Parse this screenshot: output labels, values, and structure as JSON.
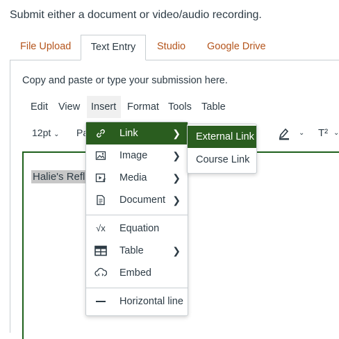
{
  "instruction": "Submit either a document or video/audio recording.",
  "tabs": [
    {
      "label": "File Upload"
    },
    {
      "label": "Text Entry"
    },
    {
      "label": "Studio"
    },
    {
      "label": "Google Drive"
    }
  ],
  "editor": {
    "help_text": "Copy and paste or type your submission here.",
    "menubar": [
      "Edit",
      "View",
      "Insert",
      "Format",
      "Tools",
      "Table"
    ],
    "font_size": "12pt",
    "paragraph_partial": "Pa",
    "superscript": "T²",
    "content_text": "Halie's Refl"
  },
  "insert_menu": {
    "items": [
      {
        "label": "Link",
        "icon": "link-icon",
        "has_submenu": true
      },
      {
        "label": "Image",
        "icon": "image-icon",
        "has_submenu": true
      },
      {
        "label": "Media",
        "icon": "media-icon",
        "has_submenu": true
      },
      {
        "label": "Document",
        "icon": "document-icon",
        "has_submenu": true
      },
      {
        "label": "Equation",
        "icon": "equation-icon",
        "has_submenu": false
      },
      {
        "label": "Table",
        "icon": "table-icon",
        "has_submenu": true
      },
      {
        "label": "Embed",
        "icon": "embed-icon",
        "has_submenu": false
      },
      {
        "label": "Horizontal line",
        "icon": "horizontal-line-icon",
        "has_submenu": false
      }
    ]
  },
  "link_submenu": {
    "items": [
      {
        "label": "External Link"
      },
      {
        "label": "Course Link"
      }
    ]
  },
  "colors": {
    "accent_green": "#2a5d1f",
    "tab_link": "#b4541b",
    "text": "#2d3b45"
  }
}
